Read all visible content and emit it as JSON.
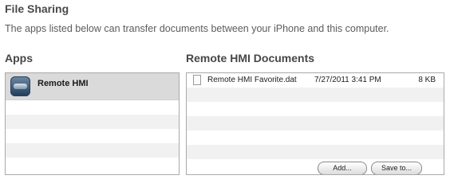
{
  "header": {
    "title": "File Sharing",
    "subtitle": "The apps listed below can transfer documents between your iPhone and this computer."
  },
  "apps": {
    "heading": "Apps",
    "items": [
      {
        "name": "Remote HMI",
        "icon": "remote-hmi-app-icon"
      }
    ]
  },
  "documents": {
    "heading": "Remote HMI Documents",
    "files": [
      {
        "name": "Remote HMI Favorite.dat",
        "date": "7/27/2011 3:41 PM",
        "size": "8 KB",
        "icon": "document-icon"
      }
    ],
    "add_label": "Add...",
    "save_label": "Save to..."
  }
}
